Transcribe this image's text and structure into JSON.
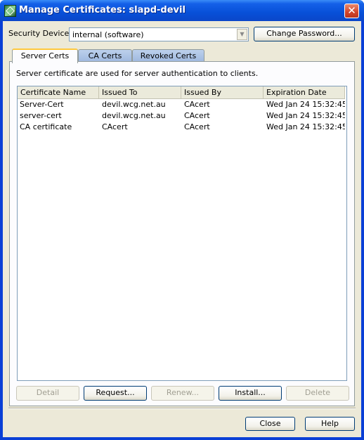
{
  "window": {
    "title": "Manage Certificates: slapd-devil"
  },
  "security": {
    "label": "Security Device:",
    "selected": "internal (software)",
    "change_password_label": "Change Password..."
  },
  "tabs": [
    {
      "label": "Server Certs",
      "active": true
    },
    {
      "label": "CA Certs",
      "active": false
    },
    {
      "label": "Revoked Certs",
      "active": false
    }
  ],
  "description": "Server certificate are used for server authentication to clients.",
  "table": {
    "columns": [
      "Certificate Name",
      "Issued To",
      "Issued By",
      "Expiration Date"
    ],
    "rows": [
      [
        "Server-Cert",
        "devil.wcg.net.au",
        "CAcert",
        "Wed Jan 24 15:32:45..."
      ],
      [
        "server-cert",
        "devil.wcg.net.au",
        "CAcert",
        "Wed Jan 24 15:32:45..."
      ],
      [
        "CA certificate",
        "CAcert",
        "CAcert",
        "Wed Jan 24 15:32:45..."
      ]
    ]
  },
  "actions": {
    "detail": "Detail",
    "request": "Request...",
    "renew": "Renew...",
    "install": "Install...",
    "delete": "Delete"
  },
  "footer": {
    "close": "Close",
    "help": "Help"
  },
  "icons": {
    "app": "certificate-app-icon",
    "close": "close-icon",
    "dropdown": "chevron-down-icon"
  },
  "colors": {
    "titlebar": "#0a54e0",
    "close_button": "#d2432a",
    "client": "#ece9d8",
    "active_tab_accent": "#ffc83c"
  }
}
